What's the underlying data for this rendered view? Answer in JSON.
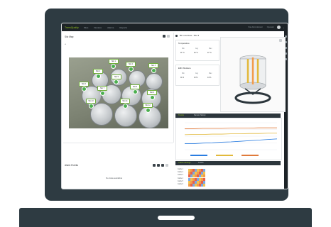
{
  "app": {
    "brand": "TransQuality",
    "nav": [
      "Sites",
      "Devices",
      "Alarms",
      "Reports"
    ],
    "user_text": "Site Administrator",
    "user_name": "Operator"
  },
  "left_panel": {
    "title": "Silo Map",
    "silo_tags": [
      "Silo 1",
      "Silo 2",
      "Silo 3",
      "Silo 4",
      "Silo 5",
      "Silo 6",
      "Silo 7",
      "Silo 8",
      "Silo 9",
      "Silo 10",
      "Silo 11",
      "Silo 12"
    ]
  },
  "bottom_left": {
    "title": "Alarm Events",
    "empty_text": "No data available"
  },
  "silo_header": {
    "title": "Bin overview - Silo 3"
  },
  "temperature_card": {
    "title": "Temperature",
    "labels": [
      "Min",
      "Avg",
      "Max"
    ],
    "values": [
      "21 °C",
      "24 °C",
      "27 °C"
    ]
  },
  "moisture_card": {
    "title": "EMC Moisture",
    "labels": [
      "Min",
      "Avg",
      "Max"
    ],
    "values": [
      "11 %",
      "13 %",
      "14 %"
    ]
  },
  "chart_tabs": {
    "active": "Trends",
    "other": "Sensor history"
  },
  "chart_data": {
    "type": "line",
    "x": [
      0,
      1,
      2,
      3,
      4,
      5,
      6,
      7,
      8,
      9,
      10
    ],
    "series": [
      {
        "values": [
          18,
          18,
          18.2,
          18.3,
          18.5,
          18.6,
          18.8,
          19,
          19.2,
          19.4,
          19.6
        ],
        "color": "#2a7de1"
      },
      {
        "values": [
          21,
          21.1,
          21.1,
          21.2,
          21.2,
          21.3,
          21.3,
          21.4,
          21.4,
          21.5,
          21.5
        ],
        "color": "#e2b93b"
      },
      {
        "values": [
          23,
          23,
          23.1,
          23.1,
          23.1,
          23.2,
          23.2,
          23.2,
          23.3,
          23.3,
          23.3
        ],
        "color": "#e07a3a"
      }
    ],
    "ylim": [
      16,
      25
    ],
    "legend": "bottom",
    "grid": true
  },
  "heatmap_tabs": {
    "active": "Cable readings",
    "other": "Levels"
  },
  "heatmap": {
    "rows": [
      "Cable 1",
      "Cable 2",
      "Cable 3",
      "Cable 4",
      "Cable 5",
      "Cable 6"
    ],
    "colors": [
      "#f2c14e",
      "#f29b4a",
      "#e8604a",
      "#7aa8e0"
    ]
  },
  "colors": {
    "accent": "#93c11f",
    "dark": "#2c363c"
  }
}
